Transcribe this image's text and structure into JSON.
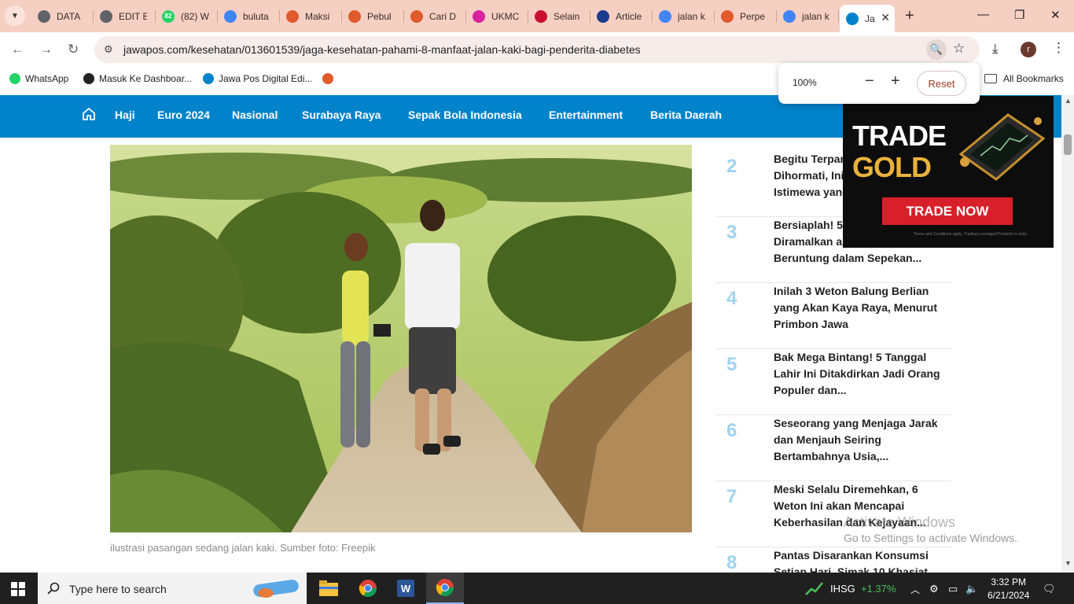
{
  "tabs": [
    {
      "title": "DATA",
      "icon": "globe-icon",
      "color": "#5f6368"
    },
    {
      "title": "EDIT E",
      "icon": "globe-icon",
      "color": "#5f6368"
    },
    {
      "title": "(82) W",
      "icon": "whatsapp-icon",
      "color": "#25d366",
      "badge": "82"
    },
    {
      "title": "buluta",
      "icon": "google-icon",
      "color": "#4285f4"
    },
    {
      "title": "Maksi",
      "icon": "jawapos-icon",
      "color": "#e05a2b"
    },
    {
      "title": "Pebul",
      "icon": "jawapos-icon",
      "color": "#e05a2b"
    },
    {
      "title": "Cari D",
      "icon": "jawapos-icon",
      "color": "#e05a2b"
    },
    {
      "title": "UKMC",
      "icon": "instagram-icon",
      "color": "#d6249f"
    },
    {
      "title": "Selain",
      "icon": "detik-icon",
      "color": "#c8102e"
    },
    {
      "title": "Article",
      "icon": "article-icon",
      "color": "#1a3c8c"
    },
    {
      "title": "jalan k",
      "icon": "google-icon",
      "color": "#4285f4"
    },
    {
      "title": "Perpe",
      "icon": "jawapos-icon",
      "color": "#e05a2b"
    },
    {
      "title": "jalan k",
      "icon": "google-icon",
      "color": "#4285f4"
    },
    {
      "title": "Ja",
      "icon": "jp-icon",
      "color": "#0083cb",
      "active": true
    }
  ],
  "toolbar": {
    "url": "jawapos.com/kesehatan/013601539/jaga-kesehatan-pahami-8-manfaat-jalan-kaki-bagi-penderita-diabetes",
    "profile_initial": "r"
  },
  "bookmarks": [
    {
      "label": "WhatsApp",
      "icon": "whatsapp-icon",
      "color": "#25d366"
    },
    {
      "label": "Masuk Ke Dashboar...",
      "icon": "dashboard-icon",
      "color": "#222222"
    },
    {
      "label": "Jawa Pos Digital Edi...",
      "icon": "jp-icon",
      "color": "#0083cb"
    },
    {
      "label": "",
      "icon": "jawapos-icon",
      "color": "#e05a2b"
    }
  ],
  "all_bookmarks": "All Bookmarks",
  "zoom_popup": {
    "value": "100%",
    "reset": "Reset"
  },
  "site_nav": [
    "Haji",
    "Euro 2024",
    "Nasional",
    "Surabaya Raya",
    "Sepak Bola Indonesia",
    "Entertainment",
    "Berita Daerah"
  ],
  "caption": "ilustrasi pasangan sedang jalan kaki. Sumber foto: Freepik",
  "trending": [
    {
      "num": "2",
      "title": "Begitu Terpandang dan Dihormati, Inilah 7 Weton Istimewa yang..."
    },
    {
      "num": "3",
      "title": "Bersiaplah! 5 Shio Ini Diramalkan akan Sangat Beruntung dalam Sepekan..."
    },
    {
      "num": "4",
      "title": "Inilah 3 Weton Balung Berlian yang Akan Kaya Raya, Menurut Primbon Jawa"
    },
    {
      "num": "5",
      "title": "Bak Mega Bintang! 5 Tanggal Lahir Ini Ditakdirkan Jadi Orang Populer dan..."
    },
    {
      "num": "6",
      "title": "Seseorang yang Menjaga Jarak dan Menjauh Seiring Bertambahnya Usia,..."
    },
    {
      "num": "7",
      "title": "Meski Selalu Diremehkan, 6 Weton Ini akan Mencapai Keberhasilan dan Kejayaan..."
    },
    {
      "num": "8",
      "title": "Pantas Disarankan Konsumsi Setiap Hari, Simak 10 Khasiat..."
    }
  ],
  "ad": {
    "line1": "TRADE",
    "line2": "GOLD",
    "button": "TRADE NOW",
    "fine_print": "Terms and Conditions apply. Trading Leveraged Products is risky."
  },
  "watermark": {
    "line1": "Activate Windows",
    "line2": "Go to Settings to activate Windows."
  },
  "taskbar": {
    "search_placeholder": "Type here to search",
    "ticker": "IHSG",
    "ticker_change": "+1.37%",
    "time": "3:32 PM",
    "date": "6/21/2024"
  },
  "colors": {
    "nav_blue": "#0083cb",
    "tab_strip": "#f6cfc3",
    "trend_num": "#9fd3ef",
    "ticker_green": "#4cc25a"
  }
}
